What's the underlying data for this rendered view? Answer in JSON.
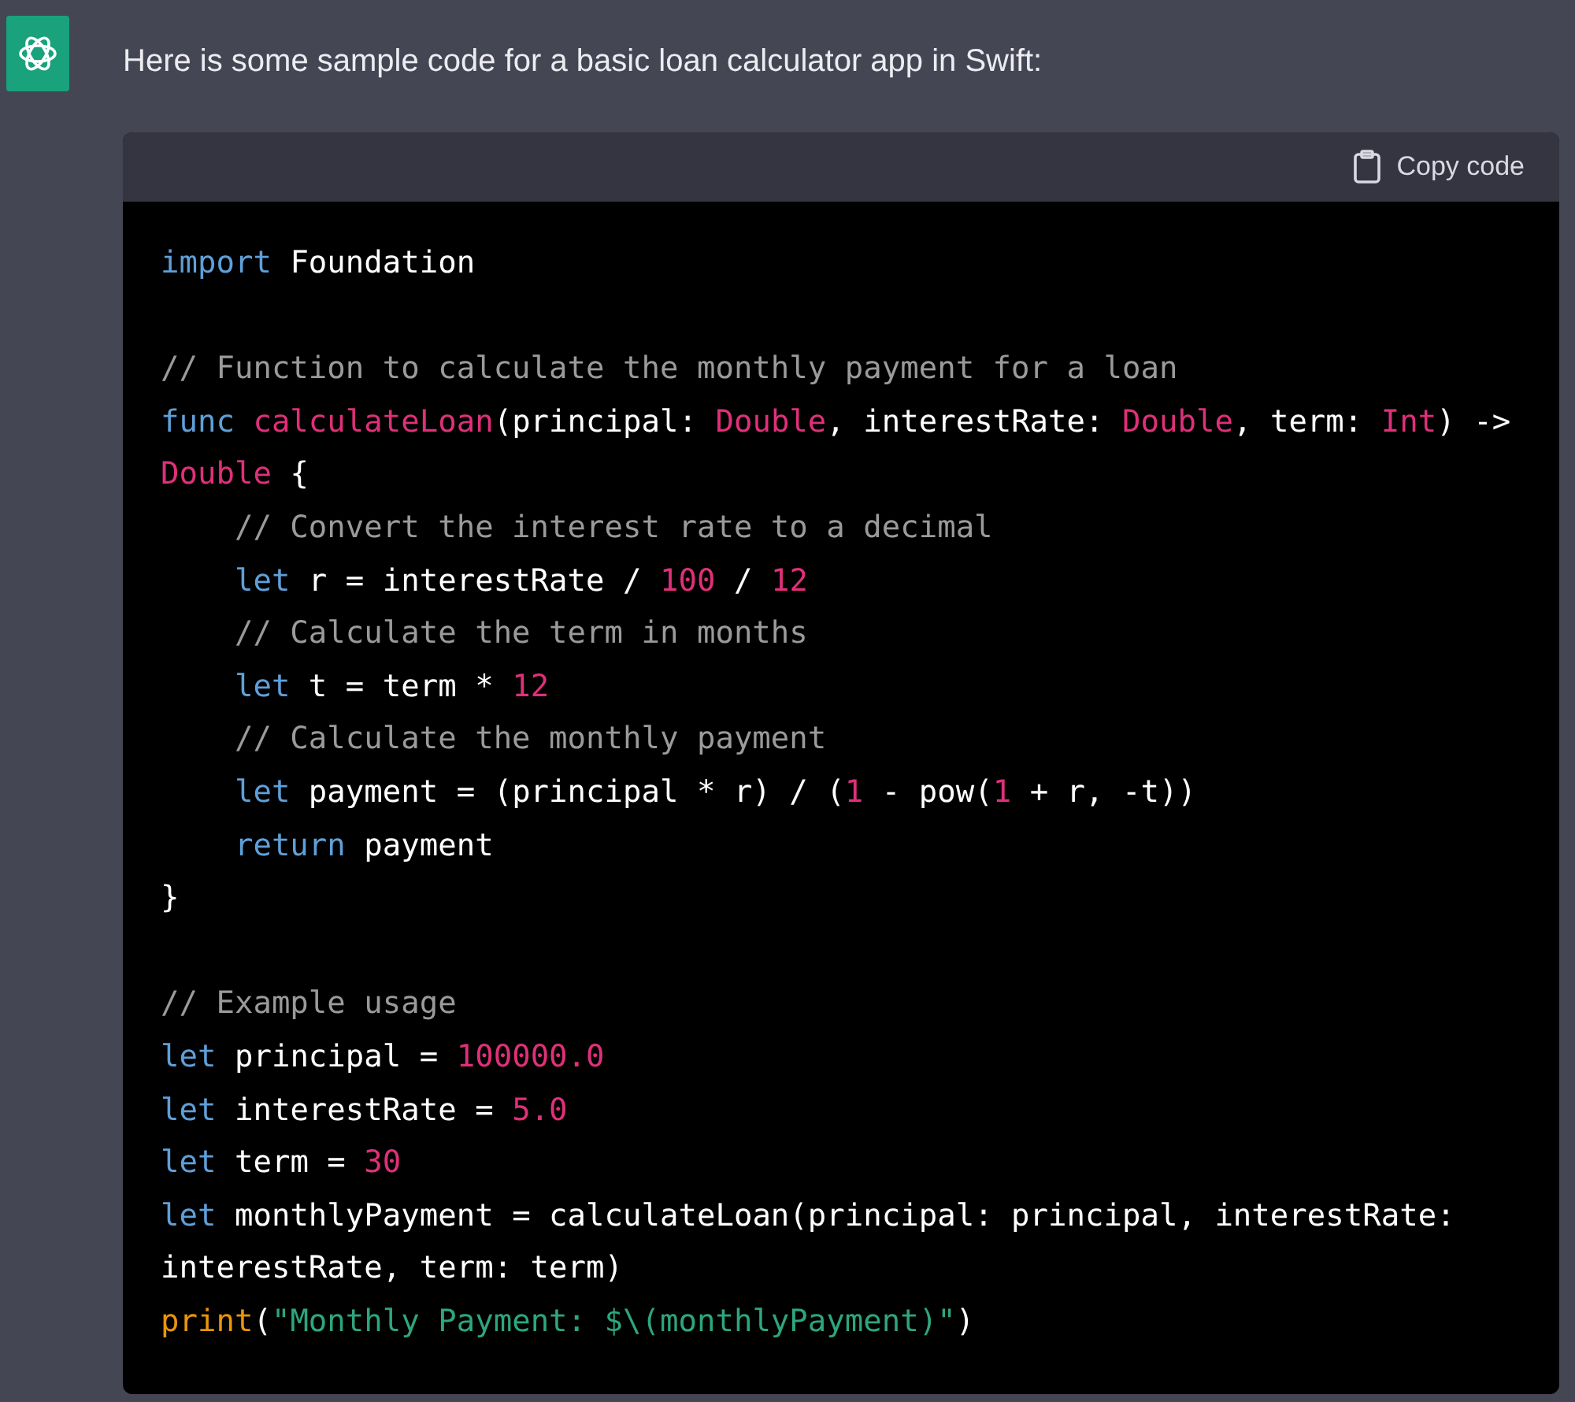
{
  "message": {
    "text": "Here is some sample code for a basic loan calculator app in Swift:"
  },
  "code_block": {
    "copy_button": "Copy code",
    "lines": [
      {
        "kind": "code",
        "tokens": [
          {
            "kind": "keyword",
            "text": "import"
          },
          {
            "kind": "plain",
            "text": " Foundation"
          }
        ]
      },
      {
        "kind": "blank"
      },
      {
        "kind": "code",
        "tokens": [
          {
            "kind": "comment",
            "text": "// Function to calculate the monthly payment for a loan"
          }
        ]
      },
      {
        "kind": "code",
        "tokens": [
          {
            "kind": "keyword",
            "text": "func "
          },
          {
            "kind": "name",
            "text": "calculateLoan"
          },
          {
            "kind": "plain",
            "text": "(principal: "
          },
          {
            "kind": "type",
            "text": "Double"
          },
          {
            "kind": "plain",
            "text": ", interestRate: "
          },
          {
            "kind": "type",
            "text": "Double"
          },
          {
            "kind": "plain",
            "text": ", term: "
          },
          {
            "kind": "type",
            "text": "Int"
          },
          {
            "kind": "plain",
            "text": ") ->"
          }
        ]
      },
      {
        "kind": "code",
        "tokens": [
          {
            "kind": "type",
            "text": "Double"
          },
          {
            "kind": "plain",
            "text": " {"
          }
        ]
      },
      {
        "kind": "code",
        "tokens": [
          {
            "kind": "comment",
            "text": "    // Convert the interest rate to a decimal"
          }
        ]
      },
      {
        "kind": "code",
        "tokens": [
          {
            "kind": "keyword",
            "text": "    let"
          },
          {
            "kind": "plain",
            "text": " r = interestRate / "
          },
          {
            "kind": "number",
            "text": "100"
          },
          {
            "kind": "plain",
            "text": " / "
          },
          {
            "kind": "number",
            "text": "12"
          }
        ]
      },
      {
        "kind": "code",
        "tokens": [
          {
            "kind": "comment",
            "text": "    // Calculate the term in months"
          }
        ]
      },
      {
        "kind": "code",
        "tokens": [
          {
            "kind": "keyword",
            "text": "    let"
          },
          {
            "kind": "plain",
            "text": " t = term * "
          },
          {
            "kind": "number",
            "text": "12"
          }
        ]
      },
      {
        "kind": "code",
        "tokens": [
          {
            "kind": "comment",
            "text": "    // Calculate the monthly payment"
          }
        ]
      },
      {
        "kind": "code",
        "tokens": [
          {
            "kind": "keyword",
            "text": "    let"
          },
          {
            "kind": "plain",
            "text": " payment = (principal * r) / ("
          },
          {
            "kind": "number",
            "text": "1"
          },
          {
            "kind": "plain",
            "text": " - pow("
          },
          {
            "kind": "number",
            "text": "1"
          },
          {
            "kind": "plain",
            "text": " + r, -t))"
          }
        ]
      },
      {
        "kind": "code",
        "tokens": [
          {
            "kind": "keyword",
            "text": "    return"
          },
          {
            "kind": "plain",
            "text": " payment"
          }
        ]
      },
      {
        "kind": "code",
        "tokens": [
          {
            "kind": "plain",
            "text": "}"
          }
        ]
      },
      {
        "kind": "blank"
      },
      {
        "kind": "code",
        "tokens": [
          {
            "kind": "comment",
            "text": "// Example usage"
          }
        ]
      },
      {
        "kind": "code",
        "tokens": [
          {
            "kind": "keyword",
            "text": "let"
          },
          {
            "kind": "plain",
            "text": " principal = "
          },
          {
            "kind": "number",
            "text": "100000.0"
          }
        ]
      },
      {
        "kind": "code",
        "tokens": [
          {
            "kind": "keyword",
            "text": "let"
          },
          {
            "kind": "plain",
            "text": " interestRate = "
          },
          {
            "kind": "number",
            "text": "5.0"
          }
        ]
      },
      {
        "kind": "code",
        "tokens": [
          {
            "kind": "keyword",
            "text": "let"
          },
          {
            "kind": "plain",
            "text": " term = "
          },
          {
            "kind": "number",
            "text": "30"
          }
        ]
      },
      {
        "kind": "code",
        "tokens": [
          {
            "kind": "keyword",
            "text": "let"
          },
          {
            "kind": "plain",
            "text": " monthlyPayment = calculateLoan(principal: principal, interestRate:"
          }
        ]
      },
      {
        "kind": "code",
        "tokens": [
          {
            "kind": "plain",
            "text": "interestRate, term: term)"
          }
        ]
      },
      {
        "kind": "code",
        "tokens": [
          {
            "kind": "builtin",
            "text": "print"
          },
          {
            "kind": "plain",
            "text": "("
          },
          {
            "kind": "string",
            "text": "\"Monthly Payment: $\\(monthlyPayment)\""
          },
          {
            "kind": "plain",
            "text": ")"
          }
        ]
      }
    ]
  }
}
